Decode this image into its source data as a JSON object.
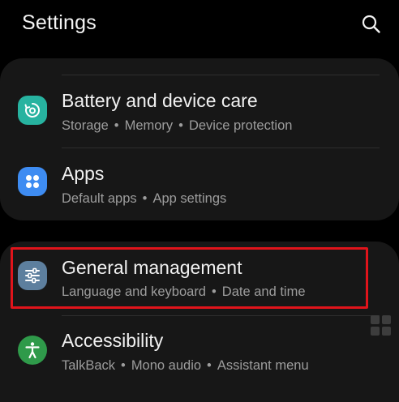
{
  "header": {
    "title": "Settings",
    "search_icon": "search-icon"
  },
  "items": [
    {
      "label": "Battery and device care",
      "subs": [
        "Storage",
        "Memory",
        "Device protection"
      ],
      "icon": "battery-care-icon",
      "color": "#27b3a0"
    },
    {
      "label": "Apps",
      "subs": [
        "Default apps",
        "App settings"
      ],
      "icon": "apps-grid-icon",
      "color": "#3e8cf2"
    },
    {
      "label": "General management",
      "subs": [
        "Language and keyboard",
        "Date and time"
      ],
      "icon": "sliders-icon",
      "color": "#5d7f9e"
    },
    {
      "label": "Accessibility",
      "subs": [
        "TalkBack",
        "Mono audio",
        "Assistant menu"
      ],
      "icon": "accessibility-icon",
      "color": "#2f9a4a"
    }
  ],
  "separator": "•",
  "colors": {
    "background": "#000000",
    "card": "#171717",
    "highlight": "#e0141b",
    "subtext": "#9d9d9d"
  }
}
